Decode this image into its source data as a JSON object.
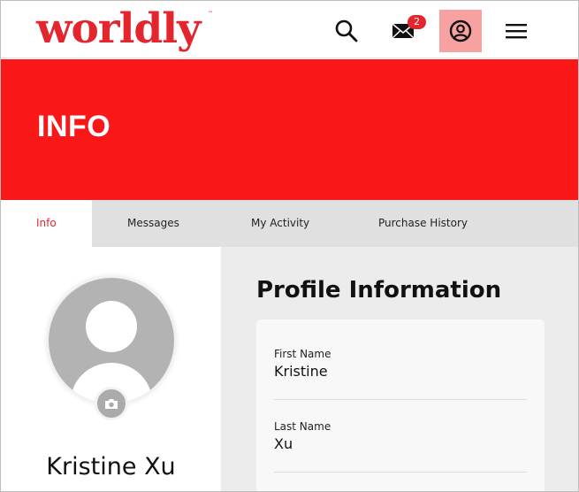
{
  "colors": {
    "brand": "#e3262d",
    "hero_bg": "#f91717",
    "badge_bg": "#e3262d",
    "active_icon_bg": "#f7a1a1"
  },
  "header": {
    "logo_text": "worldly",
    "logo_tm": "™",
    "icons": [
      "search-icon",
      "mail-icon",
      "user-circle-icon",
      "hamburger-menu-icon"
    ],
    "mail_badge": "2"
  },
  "hero": {
    "title": "INFO"
  },
  "tabs": [
    {
      "label": "Info",
      "active": true
    },
    {
      "label": "Messages",
      "active": false
    },
    {
      "label": "My Activity",
      "active": false
    },
    {
      "label": "Purchase History",
      "active": false
    }
  ],
  "profile": {
    "name": "Kristine Xu",
    "avatar_icon": "default-avatar-icon",
    "camera_icon": "camera-icon"
  },
  "info": {
    "section_title": "Profile Information",
    "fields": [
      {
        "label": "First Name",
        "value": "Kristine"
      },
      {
        "label": "Last Name",
        "value": "Xu"
      }
    ]
  }
}
